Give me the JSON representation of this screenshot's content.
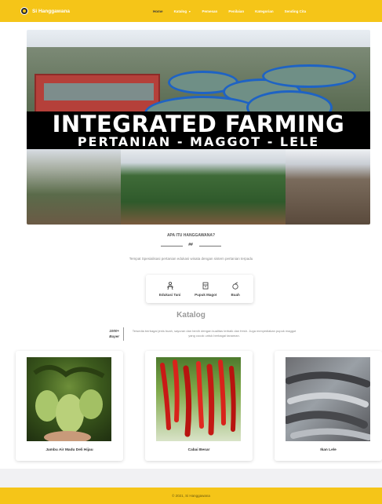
{
  "navbar": {
    "brand": "Si Hanggawana",
    "links": [
      {
        "label": "Home",
        "active": true
      },
      {
        "label": "Katalog",
        "dropdown": true
      },
      {
        "label": "Pemesan"
      },
      {
        "label": "Penilaian"
      },
      {
        "label": "Kategorian"
      },
      {
        "label": "Sending Cita"
      }
    ]
  },
  "hero": {
    "title": "INTEGRATED FARMING",
    "subtitle": "PERTANIAN - MAGGOT - LELE"
  },
  "intro": {
    "heading": "APA ITU HANGGAWANA?",
    "icon_text": "##",
    "description": "Tempat Spesialisasi pertanian edukasi wisata dengan sistem pertanian terpadu",
    "features": [
      {
        "icon": "farmer-icon",
        "label": "Edukasi Tani"
      },
      {
        "icon": "fertilizer-bag-icon",
        "label": "Pupuk Magot"
      },
      {
        "icon": "fruit-icon",
        "label": "Buah"
      }
    ]
  },
  "katalog": {
    "title": "Katalog",
    "stat_value": "1000+",
    "stat_label": "Buyer",
    "description": "Tersedia berbagai jenis buah, sayuran dan benih dengan kualitas terbaik dan fresh. Juga menyediakan pupuk maggot yang cocok untuk berbagai tanaman."
  },
  "products": [
    {
      "name": "Jambu Air Madu Deli Hijau"
    },
    {
      "name": "Cabai Besar"
    },
    {
      "name": "Ikan Lele"
    }
  ],
  "footer": {
    "text": "© 2021, Si Hanggawana"
  },
  "colors": {
    "brand_yellow": "#f5c518",
    "banner_black": "#000000"
  }
}
